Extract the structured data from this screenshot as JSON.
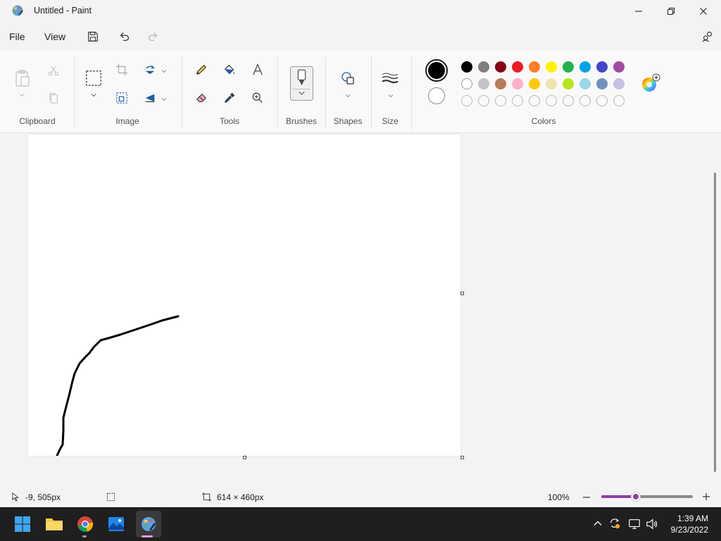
{
  "window": {
    "title": "Untitled - Paint",
    "icon": "paint-app-icon",
    "controls": [
      "minimize-icon",
      "restore-icon",
      "close-icon"
    ]
  },
  "menu": {
    "file": "File",
    "view": "View",
    "icons": [
      "save-icon",
      "undo-icon",
      "redo-icon",
      "settings-icon"
    ]
  },
  "ribbon": {
    "groups": {
      "clipboard": "Clipboard",
      "image": "Image",
      "tools": "Tools",
      "brushes": "Brushes",
      "shapes": "Shapes",
      "size": "Size",
      "colors": "Colors"
    },
    "tools": [
      "pencil-icon",
      "fill-icon",
      "text-icon",
      "eraser-icon",
      "color-picker-icon",
      "magnifier-icon"
    ],
    "primary_color": "#000000",
    "secondary_color": "#ffffff",
    "palette_row1": [
      "#000000",
      "#7f7f7f",
      "#880015",
      "#ed1c24",
      "#ff7f27",
      "#fff200",
      "#22b14c",
      "#00a2e8",
      "#3f48cc",
      "#a349a4"
    ],
    "palette_row2": [
      "#ffffff",
      "#c3c3c3",
      "#b97a57",
      "#ffaec9",
      "#ffc90e",
      "#efe4b0",
      "#b5e61d",
      "#99d9ea",
      "#7092be",
      "#c8bfe7"
    ],
    "palette_row3_custom_slots": 10
  },
  "canvas": {
    "background": "#ffffff",
    "stroke_color": "#000000"
  },
  "status": {
    "cursor_position": "-9, 505px",
    "canvas_size": "614 × 460px",
    "zoom": "100%",
    "zoom_level": 1.0
  },
  "taskbar": {
    "apps": [
      "windows-start-icon",
      "file-explorer-icon",
      "chrome-icon",
      "photos-icon",
      "paint-icon"
    ],
    "time": "1:39 AM",
    "date": "9/23/2022"
  }
}
